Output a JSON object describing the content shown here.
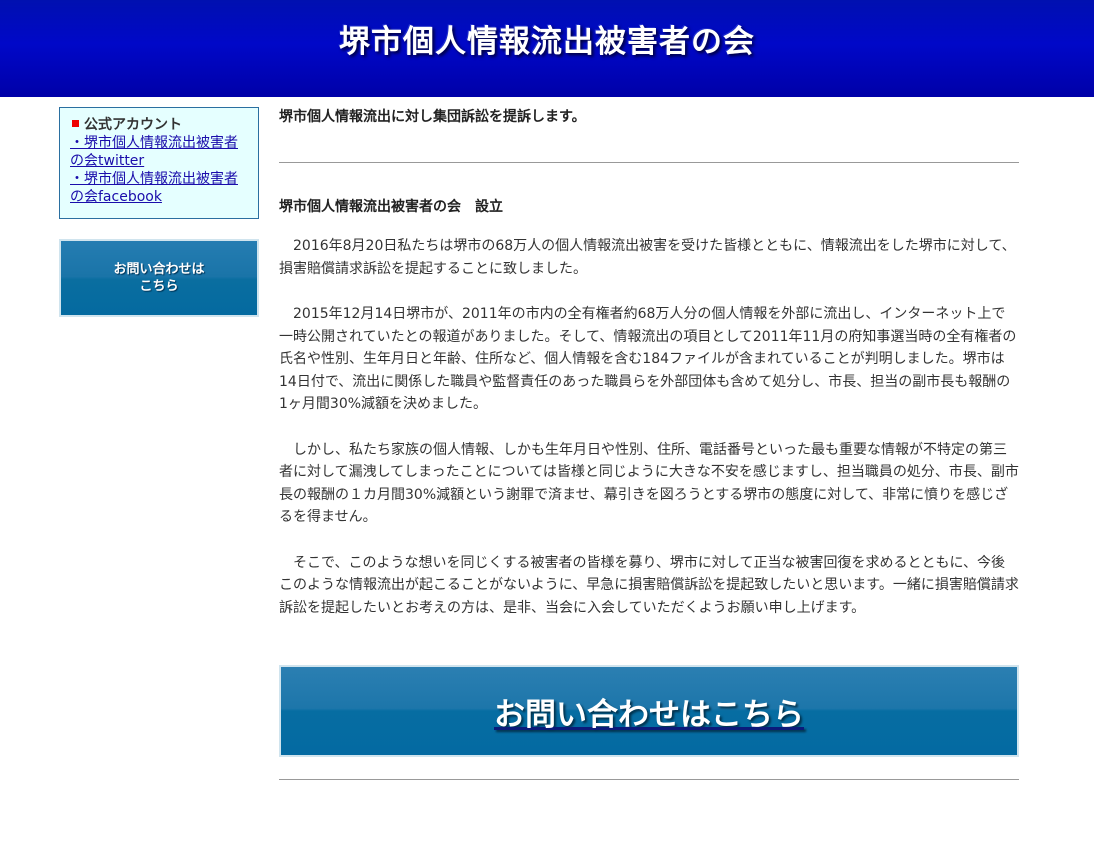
{
  "header": {
    "title": "堺市個人情報流出被害者の会"
  },
  "sidebar": {
    "account_title": "公式アカウント",
    "links": [
      {
        "text": "・堺市個人情報流出被害者の会twitter"
      },
      {
        "text": "・堺市個人情報流出被害者の会facebook"
      }
    ],
    "contact_button": "お問い合わせは\nこちら"
  },
  "main": {
    "headline": "堺市個人情報流出に対し集団訴訟を提訴します。",
    "founding_title": "堺市個人情報流出被害者の会　設立",
    "paragraphs": [
      "2016年8月20日私たちは堺市の68万人の個人情報流出被害を受けた皆様とともに、情報流出をした堺市に対して、損害賠償請求訴訟を提起することに致しました。",
      "2015年12月14日堺市が、2011年の市内の全有権者約68万人分の個人情報を外部に流出し、インターネット上で一時公開されていたとの報道がありました。そして、情報流出の項目として2011年11月の府知事選当時の全有権者の氏名や性別、生年月日と年齢、住所など、個人情報を含む184ファイルが含まれていることが判明しました。堺市は14日付で、流出に関係した職員や監督責任のあった職員らを外部団体も含めて処分し、市長、担当の副市長も報酬の1ヶ月間30%減額を決めました。",
      "しかし、私たち家族の個人情報、しかも生年月日や性別、住所、電話番号といった最も重要な情報が不特定の第三者に対して漏洩してしまったことについては皆様と同じように大きな不安を感じますし、担当職員の処分、市長、副市長の報酬の１カ月間30%減額という謝罪で済ませ、幕引きを図ろうとする堺市の態度に対して、非常に憤りを感じざるを得ません。",
      "そこで、このような想いを同じくする被害者の皆様を募り、堺市に対して正当な被害回復を求めるとともに、今後このような情報流出が起こることがないように、早急に損害賠償訴訟を提起致したいと思います。一緒に損害賠償請求訴訟を提起したいとお考えの方は、是非、当会に入会していただくようお願い申し上げます。"
    ],
    "contact_banner": "お問い合わせはこちら"
  },
  "colors": {
    "header_blue": "#0008c8",
    "button_blue": "#1a74a8",
    "account_bg": "#e5ffff",
    "bullet_red": "#ee0000"
  }
}
